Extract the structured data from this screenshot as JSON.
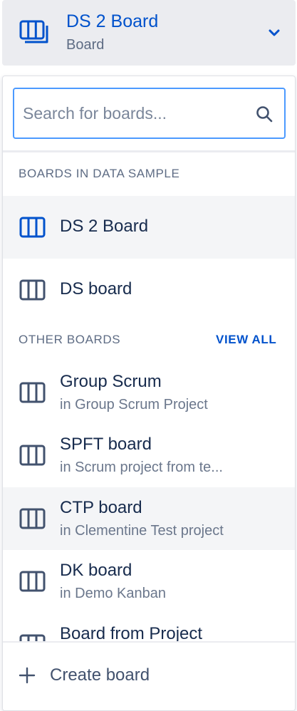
{
  "header": {
    "title": "DS 2 Board",
    "subtitle": "Board"
  },
  "search": {
    "placeholder": "Search for boards..."
  },
  "sections": {
    "data_sample_heading": "BOARDS IN DATA SAMPLE",
    "other_heading": "OTHER BOARDS",
    "view_all_label": "VIEW ALL"
  },
  "data_sample_boards": [
    {
      "name": "DS 2 Board",
      "selected": true
    },
    {
      "name": "DS board",
      "selected": false
    }
  ],
  "other_boards": [
    {
      "name": "Group Scrum",
      "project": "in Group Scrum Project"
    },
    {
      "name": "SPFT board",
      "project": "in Scrum project from te..."
    },
    {
      "name": "CTP board",
      "project": "in Clementine Test project"
    },
    {
      "name": "DK board",
      "project": "in Demo Kanban"
    },
    {
      "name": "Board from Project",
      "project": ""
    }
  ],
  "footer": {
    "create_label": "Create board"
  },
  "colors": {
    "accent": "#0052cc",
    "icon_default": "#42526e",
    "focus_border": "#4c9aff",
    "selected_bg": "#f4f5f7"
  },
  "icons": {
    "board": "board-columns-icon",
    "chevron": "chevron-down-icon",
    "search": "search-icon",
    "plus": "plus-icon"
  }
}
